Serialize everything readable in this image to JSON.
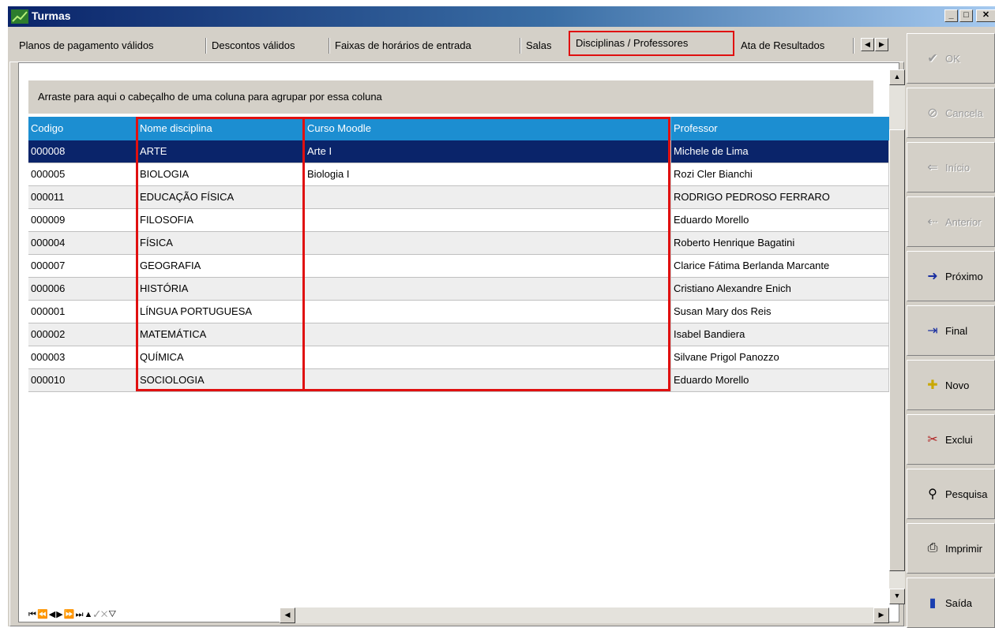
{
  "window": {
    "title": "Turmas"
  },
  "tabs": [
    "Planos de pagamento válidos",
    "Descontos válidos",
    "Faixas de horários de entrada",
    "Salas",
    "Disciplinas / Professores",
    "Ata de Resultados"
  ],
  "grid": {
    "group_hint": "Arraste para aqui o cabeçalho de uma coluna para agrupar por essa coluna",
    "columns": [
      "Codigo",
      "Nome disciplina",
      "Curso Moodle",
      "Professor"
    ],
    "rows": [
      [
        "000008",
        "ARTE",
        "Arte I",
        "Michele de Lima"
      ],
      [
        "000005",
        "BIOLOGIA",
        "Biologia I",
        "Rozi Cler Bianchi"
      ],
      [
        "000011",
        "EDUCAÇÃO FÍSICA",
        "",
        "RODRIGO PEDROSO FERRARO"
      ],
      [
        "000009",
        "FILOSOFIA",
        "",
        "Eduardo Morello"
      ],
      [
        "000004",
        "FÍSICA",
        "",
        "Roberto Henrique Bagatini"
      ],
      [
        "000007",
        "GEOGRAFIA",
        "",
        "Clarice Fátima Berlanda Marcante"
      ],
      [
        "000006",
        "HISTÓRIA",
        "",
        "Cristiano Alexandre Enich"
      ],
      [
        "000001",
        "LÍNGUA PORTUGUESA",
        "",
        "Susan Mary dos Reis"
      ],
      [
        "000002",
        "MATEMÁTICA",
        "",
        "Isabel Bandiera"
      ],
      [
        "000003",
        "QUÍMICA",
        "",
        "Silvane Prigol Panozzo"
      ],
      [
        "000010",
        "SOCIOLOGIA",
        "",
        "Eduardo Morello"
      ]
    ],
    "selected_row": 0
  },
  "sidebar": [
    {
      "label": "OK",
      "icon": "check-icon",
      "enabled": false
    },
    {
      "label": "Cancela",
      "icon": "cancel-icon",
      "enabled": false
    },
    {
      "label": "Início",
      "icon": "first-record-icon",
      "enabled": false
    },
    {
      "label": "Anterior",
      "icon": "previous-record-icon",
      "enabled": false
    },
    {
      "label": "Próximo",
      "icon": "next-record-icon",
      "enabled": true
    },
    {
      "label": "Final",
      "icon": "last-record-icon",
      "enabled": true
    },
    {
      "label": "Novo",
      "icon": "new-record-icon",
      "enabled": true
    },
    {
      "label": "Exclui",
      "icon": "delete-icon",
      "enabled": true
    },
    {
      "label": "Pesquisa",
      "icon": "search-icon",
      "enabled": true
    },
    {
      "label": "Imprimir",
      "icon": "printer-icon",
      "enabled": true
    },
    {
      "label": "Saída",
      "icon": "exit-door-icon",
      "enabled": true
    }
  ],
  "colors": {
    "header_bg": "#1c8ed1",
    "selected_row_bg": "#0a246a",
    "highlight_border": "#e01010",
    "window_bg": "#d4d0c8"
  }
}
